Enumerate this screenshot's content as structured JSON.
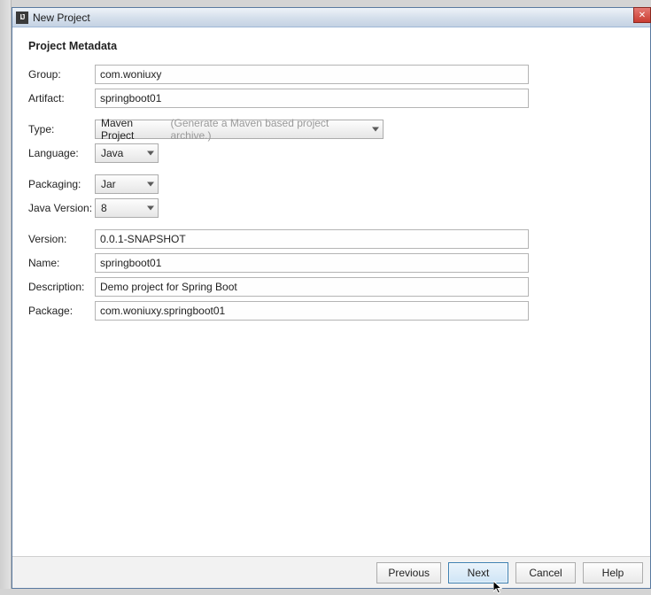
{
  "window": {
    "title": "New Project",
    "close_glyph": "✕"
  },
  "section_title": "Project Metadata",
  "labels": {
    "group": "Group:",
    "artifact": "Artifact:",
    "type": "Type:",
    "language": "Language:",
    "packaging": "Packaging:",
    "java_version": "Java Version:",
    "version": "Version:",
    "name": "Name:",
    "description": "Description:",
    "package": "Package:"
  },
  "values": {
    "group": "com.woniuxy",
    "artifact": "springboot01",
    "type_selected": "Maven Project",
    "type_hint": "(Generate a Maven based project archive.)",
    "language_selected": "Java",
    "packaging_selected": "Jar",
    "java_version_selected": "8",
    "version": "0.0.1-SNAPSHOT",
    "name": "springboot01",
    "description": "Demo project for Spring Boot",
    "package": "com.woniuxy.springboot01"
  },
  "buttons": {
    "previous": "Previous",
    "next": "Next",
    "cancel": "Cancel",
    "help": "Help"
  }
}
